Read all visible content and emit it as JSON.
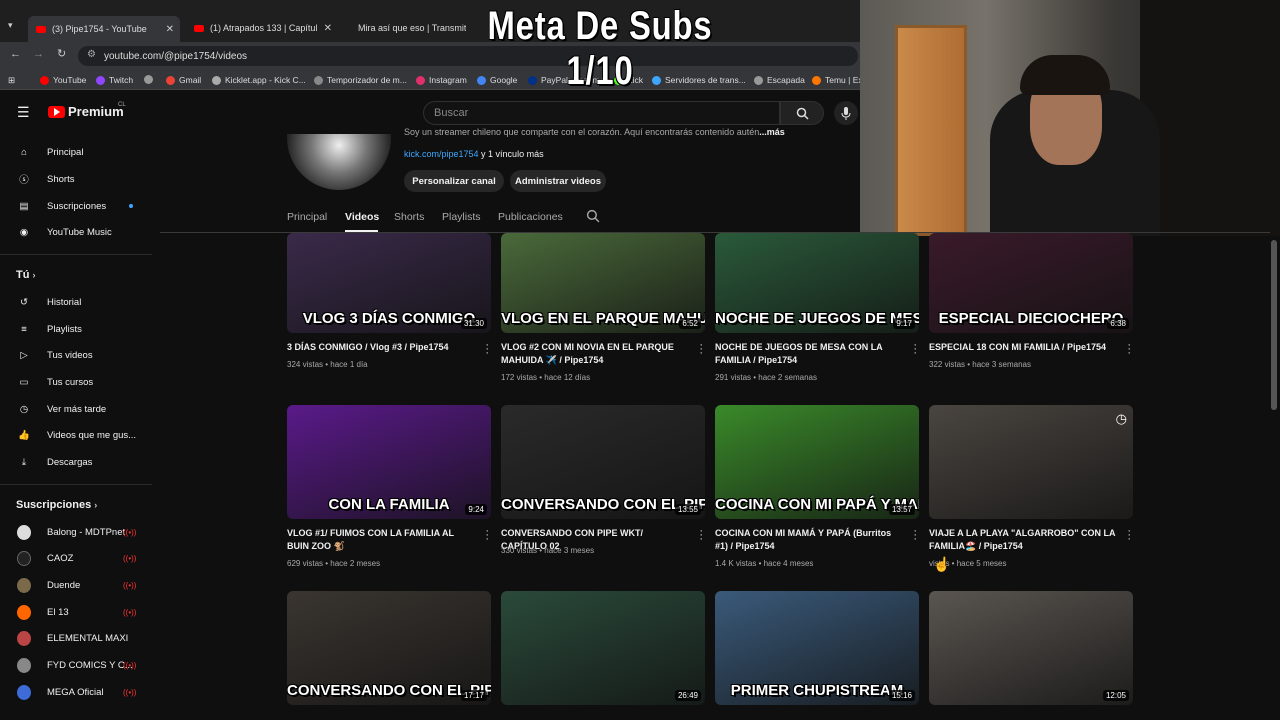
{
  "browser": {
    "tabs": [
      {
        "label": "(3) Pipe1754 - YouTube"
      },
      {
        "label": "(1) Atrapados 133 | Capítul"
      },
      {
        "label": "Mira así que eso | Transmitiend"
      }
    ],
    "url": "youtube.com/@pipe1754/videos",
    "bookmarks": [
      "YouTube",
      "Twitch",
      "Gmail",
      "Kicklet.app - Kick C...",
      "Temporizador de m...",
      "Instagram",
      "Google",
      "PayPal: Resumen",
      "Kick",
      "Servidores de trans...",
      "Escapada",
      "Temu | Ex"
    ]
  },
  "overlay": {
    "title": "Meta De Subs 1/10"
  },
  "header": {
    "logo_text": "Premium",
    "logo_region": "CL",
    "search_placeholder": "Buscar"
  },
  "sidebar": {
    "main": [
      "Principal",
      "Shorts",
      "Suscripciones",
      "YouTube Music"
    ],
    "you_header": "Tú",
    "you": [
      "Historial",
      "Playlists",
      "Tus videos",
      "Tus cursos",
      "Ver más tarde",
      "Videos que me gus...",
      "Descargas"
    ],
    "subs_header": "Suscripciones",
    "subs": [
      "Balong - MDTPnet",
      "CAOZ",
      "Duende",
      "El 13",
      "ELEMENTAL MAXI",
      "FYD COMICS Y C...",
      "MEGA Oficial"
    ]
  },
  "channel": {
    "description": "Soy un streamer chileno que comparte con el corazón. Aquí encontrarás contenido autén",
    "more": "...más",
    "link": "kick.com/pipe1754",
    "link_more": " y 1 vínculo más",
    "buttons": [
      "Personalizar canal",
      "Administrar videos"
    ],
    "tabs": [
      "Principal",
      "Videos",
      "Shorts",
      "Playlists",
      "Publicaciones"
    ]
  },
  "videos": [
    {
      "title": "3 DÍAS CONMIGO / Vlog #3 / Pipe1754",
      "meta": "324 vistas • hace 1 día",
      "duration": "31:30",
      "caption": "VLOG 3 DÍAS CONMIGO",
      "bg": "#3a2a4a"
    },
    {
      "title": "VLOG #2 CON MI NOVIA EN EL PARQUE MAHUIDA ✈️ / Pipe1754",
      "meta": "172 vistas • hace 12 días",
      "duration": "6:52",
      "caption": "VLOG EN EL PARQUE MAHUIDA",
      "bg": "#4a6a3a"
    },
    {
      "title": "NOCHE DE JUEGOS DE MESA CON LA FAMILIA / Pipe1754",
      "meta": "291 vistas • hace 2 semanas",
      "duration": "9:17",
      "caption": "NOCHE DE JUEGOS DE MESA",
      "bg": "#2a5a3a"
    },
    {
      "title": "ESPECIAL 18 CON MI FAMILIA / Pipe1754",
      "meta": "322 vistas • hace 3 semanas",
      "duration": "6:38",
      "caption": "ESPECIAL DIECIOCHERO",
      "bg": "#3a1a2a"
    },
    {
      "title": "VLOG #1/ FUIMOS CON LA FAMILIA AL BUIN ZOO 🐒",
      "meta": "629 vistas • hace 2 meses",
      "duration": "9:24",
      "caption": "CON LA FAMILIA",
      "bg": "#5a1a8a"
    },
    {
      "title": "CONVERSANDO CON PIPE WKT/ CAPÍTULO 02",
      "meta": "330 vistas • hace 3 meses",
      "duration": "13:55",
      "caption": "CONVERSANDO CON EL PIPEWKT",
      "bg": "#2a2a2a"
    },
    {
      "title": "COCINA CON MI MAMÁ Y PAPÁ (Burritos #1) / Pipe1754",
      "meta": "1.4 K vistas • hace 4 meses",
      "duration": "13:57",
      "caption": "COCINA CON MI PAPÁ Y MAMÁ",
      "bg": "#3a8a2a"
    },
    {
      "title": "VIAJE A LA PLAYA \"ALGARROBO\" CON LA FAMILIA🏖️ / Pipe1754",
      "meta": "vistas • hace 5 meses",
      "duration": "",
      "caption": "",
      "bg": "#4a4540"
    },
    {
      "title": "",
      "meta": "",
      "duration": "17:17",
      "caption": "CONVERSANDO CON EL PIPE",
      "bg": "#3a3530"
    },
    {
      "title": "",
      "meta": "",
      "duration": "26:49",
      "caption": "",
      "bg": "#2a4a3a"
    },
    {
      "title": "",
      "meta": "",
      "duration": "15:16",
      "caption": "PRIMER CHUPISTREAM",
      "bg": "#3a5a7a"
    },
    {
      "title": "",
      "meta": "",
      "duration": "12:05",
      "caption": "",
      "bg": "#5a5550"
    }
  ]
}
